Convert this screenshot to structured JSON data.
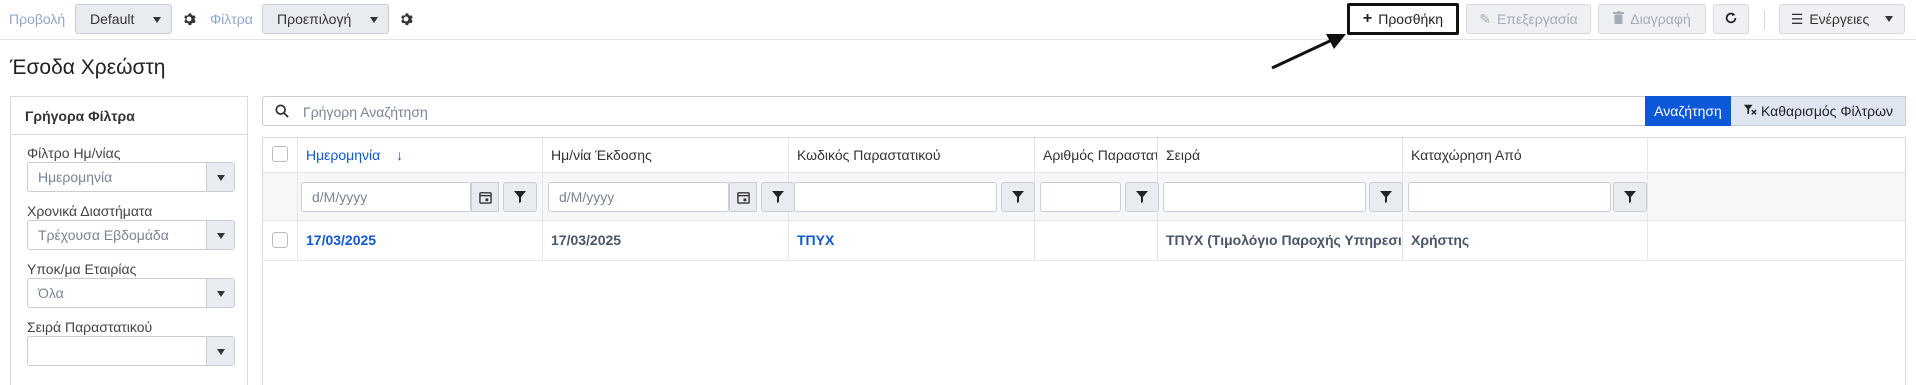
{
  "toolbar": {
    "view_label": "Προβολή",
    "view_value": "Default",
    "filters_label": "Φίλτρα",
    "filters_value": "Προεπιλογή",
    "add_label": "Προσθήκη",
    "edit_label": "Επεξεργασία",
    "delete_label": "Διαγραφή",
    "actions_label": "Ενέργειες"
  },
  "page": {
    "title": "Έσοδα Χρεώστη"
  },
  "sidebar": {
    "title": "Γρήγορα Φίλτρα",
    "filters": [
      {
        "label": "Φίλτρο Ημ/νίας",
        "value": "Ημερομηνία"
      },
      {
        "label": "Χρονικά Διαστήματα",
        "value": "Τρέχουσα Εβδομάδα"
      },
      {
        "label": "Υποκ/μα Εταιρίας",
        "value": "Όλα"
      },
      {
        "label": "Σειρά Παραστατικού",
        "value": ""
      }
    ]
  },
  "search": {
    "placeholder": "Γρήγορη Αναζήτηση",
    "search_button": "Αναζήτηση",
    "clear_button": "Καθαρισμός Φίλτρων"
  },
  "grid": {
    "columns": [
      "Ημερομηνία",
      "Ημ/νία Έκδοσης",
      "Κωδικός Παραστατικού",
      "Αριθμός Παραστατ...",
      "Σειρά",
      "Καταχώρηση Από"
    ],
    "sort_arrow": "↓",
    "date_placeholder": "d/M/yyyy",
    "rows": [
      [
        "17/03/2025",
        "17/03/2025",
        "ΤΠΥΧ",
        "",
        "ΤΠΥΧ (Τιμολόγιο Παροχής Υπηρεσιών ...",
        "Χρήστης"
      ]
    ]
  },
  "colors": {
    "accent": "#0d58d8",
    "clear_bg": "#dfe6f2"
  }
}
